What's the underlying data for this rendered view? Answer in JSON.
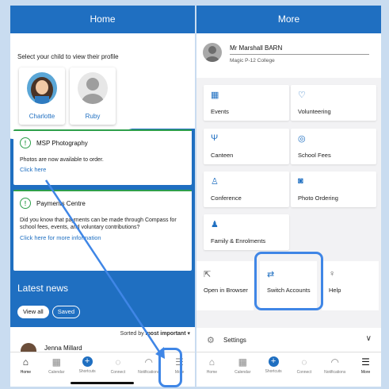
{
  "left": {
    "header_title": "Home",
    "prompt": "Select your child to view their profile",
    "children": [
      "Charlotte",
      "Ruby"
    ],
    "card1": {
      "title": "MSP Photography",
      "body": "Photos are now available to order.",
      "link": "Click here"
    },
    "card2": {
      "title": "Payments Centre",
      "body": "Did you know that payments can be made through Compass for school fees, events, and voluntary contributions?",
      "link": "Click here for more information"
    },
    "latest_news": "Latest news",
    "pills": [
      "View all",
      "Saved"
    ],
    "sort_prefix": "Sorted by",
    "sort_value": "most important",
    "news_author": "Jenna Millard"
  },
  "tabs": [
    "Home",
    "Calendar",
    "Shortcuts",
    "Connect",
    "Notifications",
    "More"
  ],
  "right": {
    "header_title": "More",
    "profile_name": "Mr Marshall BARN",
    "profile_school": "Magic P-12 College",
    "tiles": [
      "Events",
      "Volunteering",
      "Canteen",
      "School Fees",
      "Conference",
      "Photo Ordering",
      "Family & Enrolments"
    ],
    "actions": [
      "Open in Browser",
      "Switch Accounts",
      "Help"
    ],
    "settings": "Settings"
  },
  "colors": {
    "brand_blue": "#1f6fc1",
    "alert_green": "#2e9f4b",
    "highlight": "#3f86e6"
  }
}
